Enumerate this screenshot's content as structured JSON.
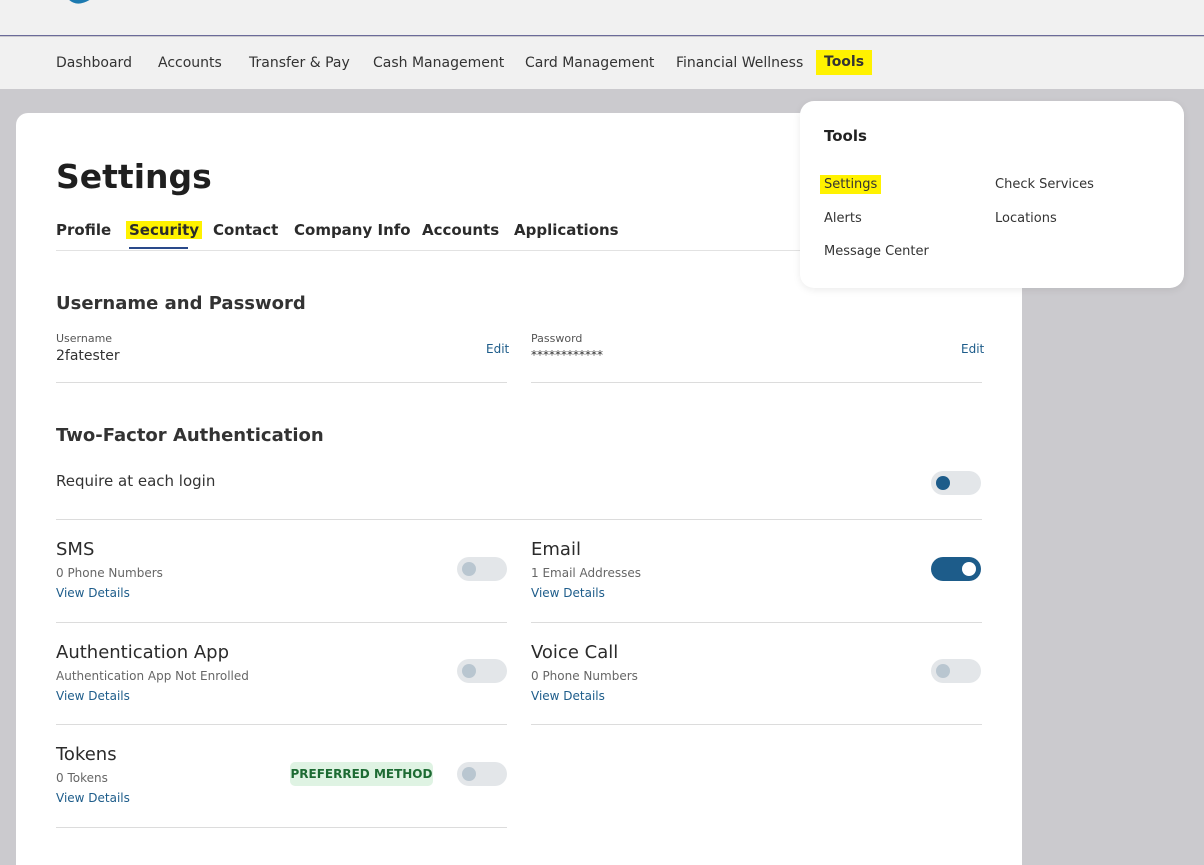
{
  "nav": {
    "items": [
      "Dashboard",
      "Accounts",
      "Transfer & Pay",
      "Cash Management",
      "Card Management",
      "Financial Wellness",
      "Tools"
    ]
  },
  "page": {
    "title": "Settings",
    "tabs": [
      "Profile",
      "Security",
      "Contact",
      "Company Info",
      "Accounts",
      "Applications"
    ],
    "active_tab": "Security"
  },
  "credentials": {
    "section_title": "Username and Password",
    "username_label": "Username",
    "username_value": "2fatester",
    "password_label": "Password",
    "password_value": "************",
    "edit_label": "Edit"
  },
  "two_factor": {
    "section_title": "Two-Factor Authentication",
    "require_label": "Require at each login",
    "require_enabled": false,
    "view_details": "View Details",
    "methods": {
      "sms": {
        "title": "SMS",
        "sub": "0 Phone Numbers",
        "enabled": false
      },
      "email": {
        "title": "Email",
        "sub": "1 Email Addresses",
        "enabled": true
      },
      "auth_app": {
        "title": "Authentication App",
        "sub": "Authentication App Not Enrolled",
        "enabled": false
      },
      "voice": {
        "title": "Voice Call",
        "sub": "0 Phone Numbers",
        "enabled": false
      },
      "tokens": {
        "title": "Tokens",
        "sub": "0 Tokens",
        "badge": "PREFERRED METHOD",
        "enabled": false
      }
    }
  },
  "tools_menu": {
    "title": "Tools",
    "items": [
      "Settings",
      "Alerts",
      "Message Center",
      "Check Services",
      "Locations"
    ]
  },
  "colors": {
    "highlight": "#fff200",
    "link": "#1d5c8a",
    "toggle_on": "#1d5c8a",
    "badge_bg": "#dff3e3",
    "badge_text": "#1d6b33"
  }
}
